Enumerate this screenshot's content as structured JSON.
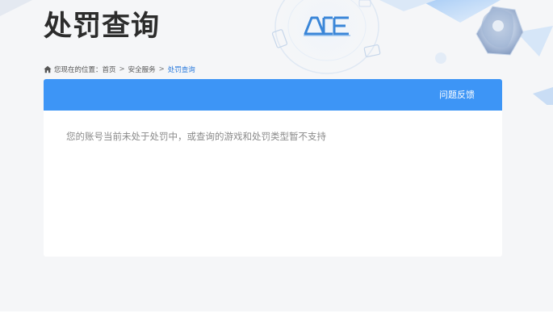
{
  "page": {
    "title": "处罚查询"
  },
  "logo": {
    "text": "ACE"
  },
  "breadcrumb": {
    "prefix": "您现在的位置：",
    "items": [
      "首页",
      "安全服务",
      "处罚查询"
    ],
    "separator": ">"
  },
  "panel": {
    "feedback_label": "问题反馈",
    "message": "您的账号当前未处于处罚中，或查询的游戏和处罚类型暂不支持"
  },
  "colors": {
    "accent": "#3d95f6",
    "breadcrumb_active": "#2b7bdc",
    "title": "#2c2c2c",
    "background": "#f5f6f8"
  },
  "icons": {
    "breadcrumb": "home-icon",
    "header_logo": "ace-logo",
    "decoration": "character-avatar"
  }
}
